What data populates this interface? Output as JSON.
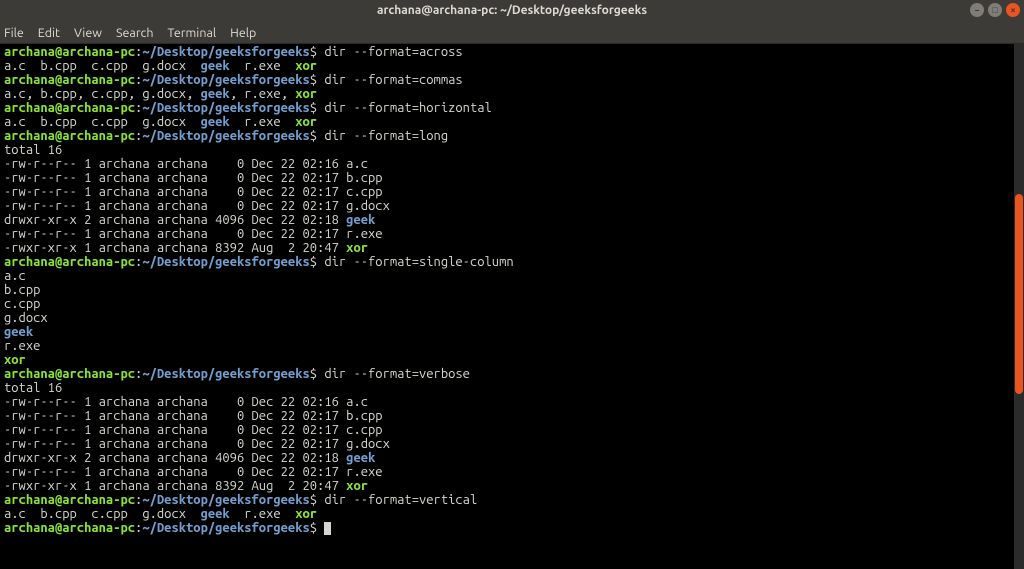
{
  "title": "archana@archana-pc: ~/Desktop/geeksforgeeks",
  "menubar": [
    "File",
    "Edit",
    "View",
    "Search",
    "Terminal",
    "Help"
  ],
  "prompt": {
    "user": "archana@archana-pc",
    "sep1": ":",
    "path": "~/Desktop/geeksforgeeks",
    "sep2": "$"
  },
  "files_across": "a.c  b.cpp  c.cpp  g.docx  ",
  "files_dir": "geek",
  "files_exe1": "  r.exe  ",
  "files_exe2": "xor",
  "files_commas": "a.c, b.cpp, c.cpp, g.docx, ",
  "files_commas_dir": "geek",
  "files_commas_exe1": ", r.exe, ",
  "files_commas_exe2": "xor",
  "cmds": {
    "across": " dir --format=across",
    "commas": " dir --format=commas",
    "horizontal": " dir --format=horizontal",
    "long": " dir --format=long",
    "single": " dir --format=single-column",
    "verbose": " dir --format=verbose",
    "vertical": " dir --format=vertical"
  },
  "total": "total 16",
  "long_listing": [
    {
      "perm": "-rw-r--r-- 1 archana archana    0 Dec 22 02:16 ",
      "name": "a.c",
      "cls": "out"
    },
    {
      "perm": "-rw-r--r-- 1 archana archana    0 Dec 22 02:17 ",
      "name": "b.cpp",
      "cls": "out"
    },
    {
      "perm": "-rw-r--r-- 1 archana archana    0 Dec 22 02:17 ",
      "name": "c.cpp",
      "cls": "out"
    },
    {
      "perm": "-rw-r--r-- 1 archana archana    0 Dec 22 02:17 ",
      "name": "g.docx",
      "cls": "out"
    },
    {
      "perm": "drwxr-xr-x 2 archana archana 4096 Dec 22 02:18 ",
      "name": "geek",
      "cls": "dir"
    },
    {
      "perm": "-rw-r--r-- 1 archana archana    0 Dec 22 02:17 ",
      "name": "r.exe",
      "cls": "out"
    },
    {
      "perm": "-rwxr-xr-x 1 archana archana 8392 Aug  2 20:47 ",
      "name": "xor",
      "cls": "exe"
    }
  ],
  "single_col": [
    "a.c",
    "b.cpp",
    "c.cpp",
    "g.docx",
    "geek",
    "r.exe",
    "xor"
  ],
  "single_col_cls": [
    "out",
    "out",
    "out",
    "out",
    "dir",
    "out",
    "exe"
  ]
}
